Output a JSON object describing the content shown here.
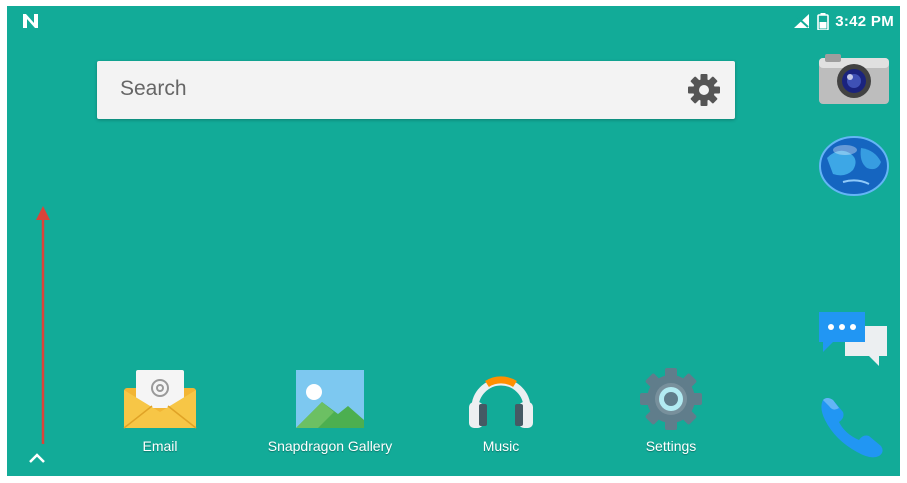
{
  "status_bar": {
    "time": "3:42 PM",
    "notification_icon": "n-notification-icon",
    "signal_icon": "no-signal-icon",
    "battery_icon": "battery-icon"
  },
  "search": {
    "placeholder": "Search",
    "settings_icon": "gear-icon"
  },
  "dock": {
    "apps": [
      {
        "label": "Email",
        "icon": "email-icon"
      },
      {
        "label": "Snapdragon Gallery",
        "icon": "gallery-icon"
      },
      {
        "label": "Music",
        "icon": "headphones-icon"
      },
      {
        "label": "Settings",
        "icon": "settings-gear-icon"
      }
    ]
  },
  "side_apps": [
    {
      "icon": "camera-icon"
    },
    {
      "icon": "browser-globe-icon"
    },
    {
      "icon": "messaging-icon"
    },
    {
      "icon": "phone-icon"
    }
  ],
  "colors": {
    "wallpaper": "#12ab98",
    "arrow": "#d9443a"
  }
}
